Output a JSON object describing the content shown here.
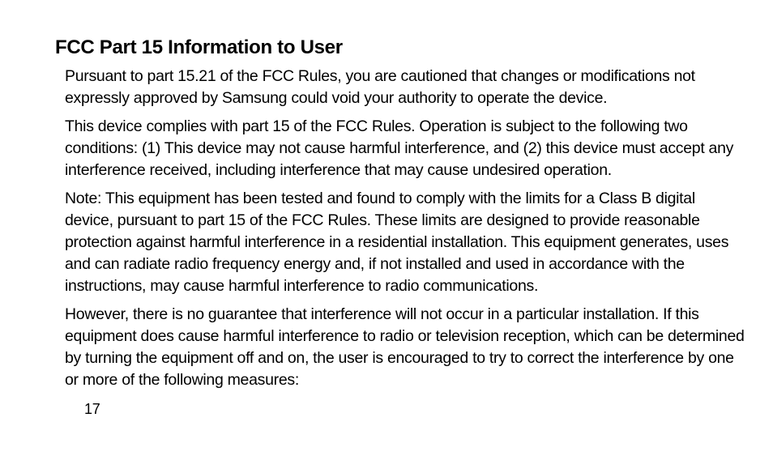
{
  "heading": "FCC Part 15 Information to User",
  "paragraphs": [
    "Pursuant to part 15.21 of the FCC Rules, you are cautioned that changes or modifications not expressly approved by Samsung could void your authority to operate the device.",
    "This device complies with part 15 of the FCC Rules. Operation is subject to the following two conditions: (1) This device may not cause harmful interference, and (2) this device must accept any interference received, including interference that may cause undesired operation.",
    "Note: This equipment has been tested and found to comply with the limits for a Class B digital device, pursuant to part 15 of the FCC Rules. These limits are designed to provide reasonable protection against harmful interference in a residential installation. This equipment generates, uses and can radiate radio frequency energy and, if not installed and used in accordance with the instructions, may cause harmful interference to radio communications.",
    "However, there is no guarantee that interference will not occur in a particular installation. If this equipment does cause harmful interference to radio or television reception, which can be determined by turning the equipment off and on, the user is encouraged to try to correct the interference by one or more of the following measures:"
  ],
  "page_number": "17"
}
